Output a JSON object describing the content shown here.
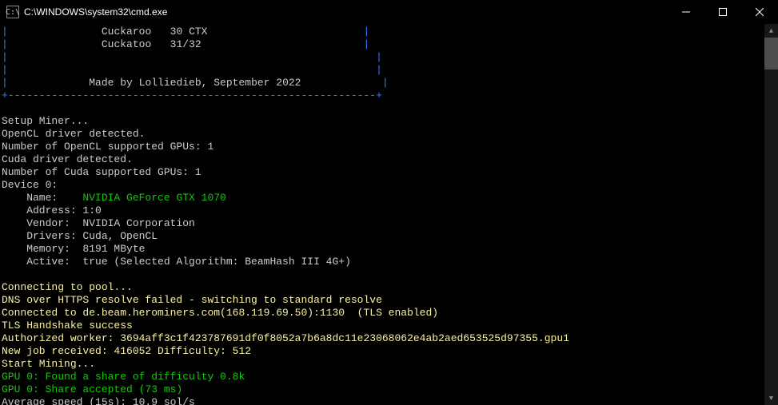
{
  "window": {
    "icon_text": "C:\\",
    "title": "C:\\WINDOWS\\system32\\cmd.exe"
  },
  "banner": {
    "row1_algo": "Cuckaroo",
    "row1_val": "30 CTX",
    "row2_algo": "Cuckatoo",
    "row2_val": "31/32",
    "credits": "Made by Lolliedieb, September 2022"
  },
  "setup": {
    "l1": "Setup Miner...",
    "l2": "OpenCL driver detected.",
    "l3": "Number of OpenCL supported GPUs: 1",
    "l4": "Cuda driver detected.",
    "l5": "Number of Cuda supported GPUs: 1"
  },
  "device": {
    "header": "Device 0:",
    "name_label": "    Name:    ",
    "name_value": "NVIDIA GeForce GTX 1070",
    "address": "    Address: 1:0",
    "vendor": "    Vendor:  NVIDIA Corporation",
    "drivers": "    Drivers: Cuda, OpenCL",
    "memory": "    Memory:  8191 MByte",
    "active": "    Active:  true (Selected Algorithm: BeamHash III 4G+)"
  },
  "conn": {
    "l1": "Connecting to pool...",
    "l2": "DNS over HTTPS resolve failed - switching to standard resolve",
    "l3": "Connected to de.beam.herominers.com(168.119.69.50):1130  (TLS enabled)",
    "l4": "TLS Handshake success",
    "l5": "Authorized worker: 3694aff3c1f423787691df0f8052a7b6a8dc11e23068062e4ab2aed653525d97355.gpu1",
    "l6": "New job received: 416052 Difficulty: 512",
    "l7": "Start Mining...",
    "l8": "GPU 0: Found a share of difficulty 0.8k",
    "l9": "GPU 0: Share accepted (73 ms)",
    "l10": "Average speed (15s): 10.9 sol/s"
  }
}
